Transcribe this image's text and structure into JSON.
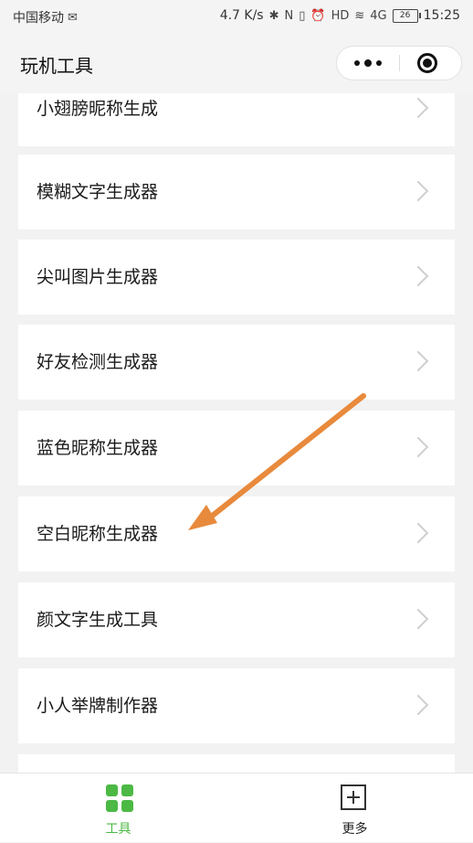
{
  "status_bar": {
    "carrier": "中国移动",
    "speed": "4.7 K/s",
    "network": "4G",
    "battery": "26",
    "time": "15:25"
  },
  "header": {
    "title": "玩机工具"
  },
  "tools": [
    {
      "label": "小翅膀昵称生成"
    },
    {
      "label": "模糊文字生成器"
    },
    {
      "label": "尖叫图片生成器"
    },
    {
      "label": "好友检测生成器"
    },
    {
      "label": "蓝色昵称生成器"
    },
    {
      "label": "空白昵称生成器"
    },
    {
      "label": "颜文字生成工具"
    },
    {
      "label": "小人举牌制作器"
    }
  ],
  "annotation": {
    "arrow_color": "#e88a3c",
    "target": "空白昵称生成器"
  },
  "tab_bar": {
    "tabs": [
      {
        "label": "工具",
        "icon": "grid-icon",
        "active": true,
        "color": "#4cb944"
      },
      {
        "label": "更多",
        "icon": "plus-square-icon",
        "active": false
      }
    ]
  }
}
